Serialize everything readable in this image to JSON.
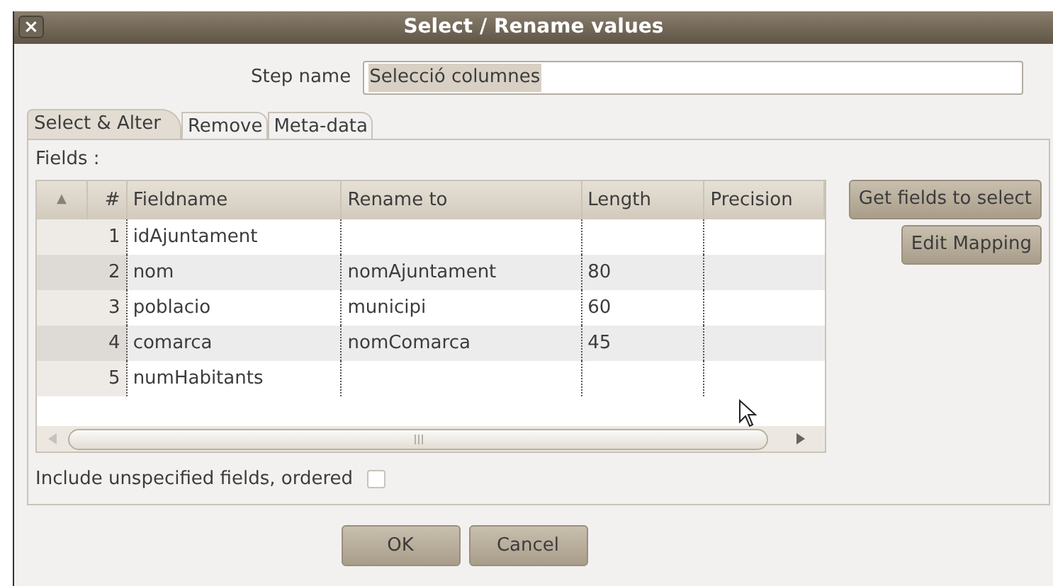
{
  "window": {
    "title": "Select / Rename values",
    "close": "×"
  },
  "step_name": {
    "label": "Step name",
    "value": "Selecció columnes"
  },
  "tabs": [
    {
      "label": "Select & Alter",
      "selected": true
    },
    {
      "label": "Remove",
      "selected": false
    },
    {
      "label": "Meta-data",
      "selected": false
    }
  ],
  "fields_label": "Fields :",
  "table": {
    "columns": [
      "▲",
      "#",
      "Fieldname",
      "Rename to",
      "Length",
      "Precision"
    ],
    "rows": [
      [
        "",
        "1",
        "idAjuntament",
        "",
        "",
        ""
      ],
      [
        "",
        "2",
        "nom",
        "nomAjuntament",
        "80",
        ""
      ],
      [
        "",
        "3",
        "poblacio",
        "municipi",
        "60",
        ""
      ],
      [
        "",
        "4",
        "comarca",
        "nomComarca",
        "45",
        ""
      ],
      [
        "",
        "5",
        "numHabitants",
        "",
        "",
        ""
      ]
    ]
  },
  "side_buttons": [
    "Get fields to select",
    "Edit Mapping"
  ],
  "include_unspecified": {
    "label": "Include unspecified fields, ordered",
    "checked": false
  },
  "buttons": [
    "OK",
    "Cancel"
  ]
}
